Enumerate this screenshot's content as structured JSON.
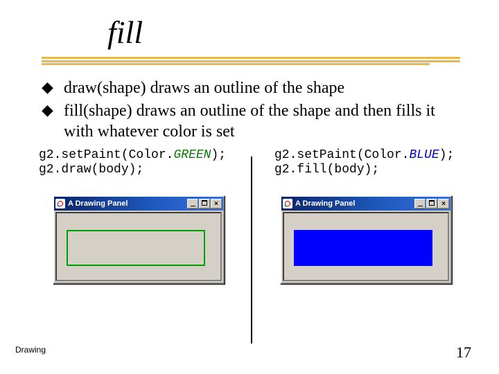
{
  "title": "fill",
  "bullets": [
    {
      "text": "draw(shape) draws an outline of the shape"
    },
    {
      "text": "fill(shape) draws an outline of the shape and then fills it with whatever color is set",
      "cont": true
    }
  ],
  "code": {
    "left": {
      "prefix1": "g2.setPaint(Color.",
      "em1": "GREEN",
      "suffix1": ");",
      "line2": "g2.draw(body);"
    },
    "right": {
      "prefix1": "g2.setPaint(Color.",
      "em1": "BLUE",
      "suffix1": ");",
      "line2": "g2.fill(body);"
    }
  },
  "window": {
    "title": "A Drawing Panel",
    "buttons": {
      "min": "_",
      "max": "□",
      "close": "×"
    }
  },
  "footer": {
    "label": "Drawing",
    "page": "17"
  }
}
